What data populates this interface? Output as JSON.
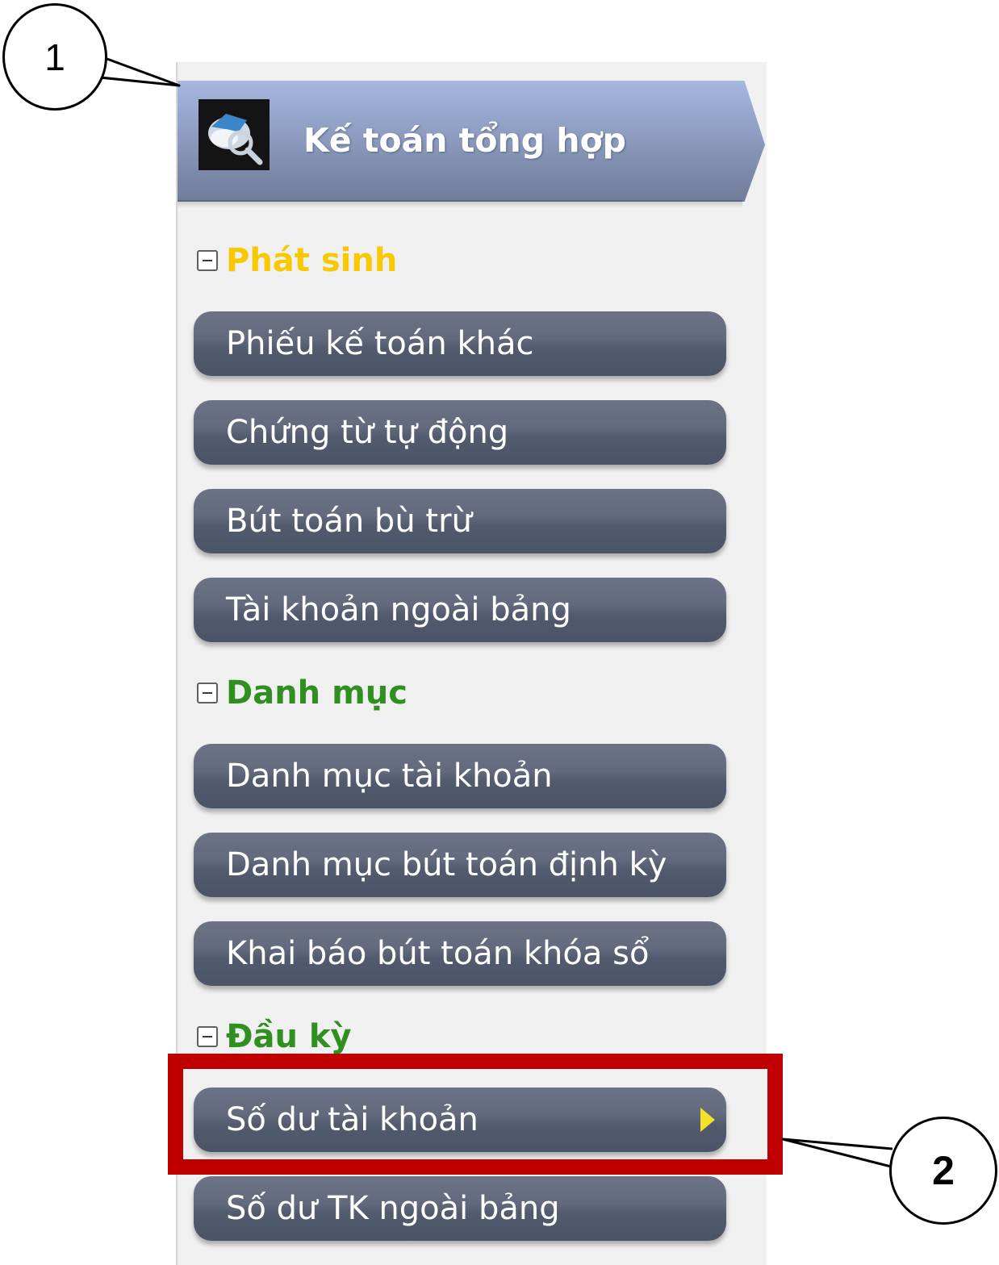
{
  "header": {
    "title": "Kế toán tổng hợp",
    "icon": "accounting-app-icon"
  },
  "sections": [
    {
      "label": "Phát sinh",
      "color": "#f8c800"
    },
    {
      "label": "Danh mục",
      "color": "#2f8f1f"
    },
    {
      "label": "Đầu kỳ",
      "color": "#2f8f1f"
    }
  ],
  "menu": {
    "phat_sinh": [
      {
        "label": "Phiếu kế toán khác"
      },
      {
        "label": "Chứng từ tự động"
      },
      {
        "label": "Bút toán bù trừ"
      },
      {
        "label": "Tài khoản ngoài bảng"
      }
    ],
    "danh_muc": [
      {
        "label": "Danh mục tài khoản"
      },
      {
        "label": "Danh mục bút toán định kỳ"
      },
      {
        "label": "Khai báo bút toán khóa sổ"
      }
    ],
    "dau_ky": [
      {
        "label": "Số dư tài khoản",
        "selected": true
      },
      {
        "label": "Số dư TK ngoài bảng"
      }
    ]
  },
  "annotations": {
    "callout_1": "1",
    "callout_2": "2",
    "highlight_color": "#c00000"
  }
}
